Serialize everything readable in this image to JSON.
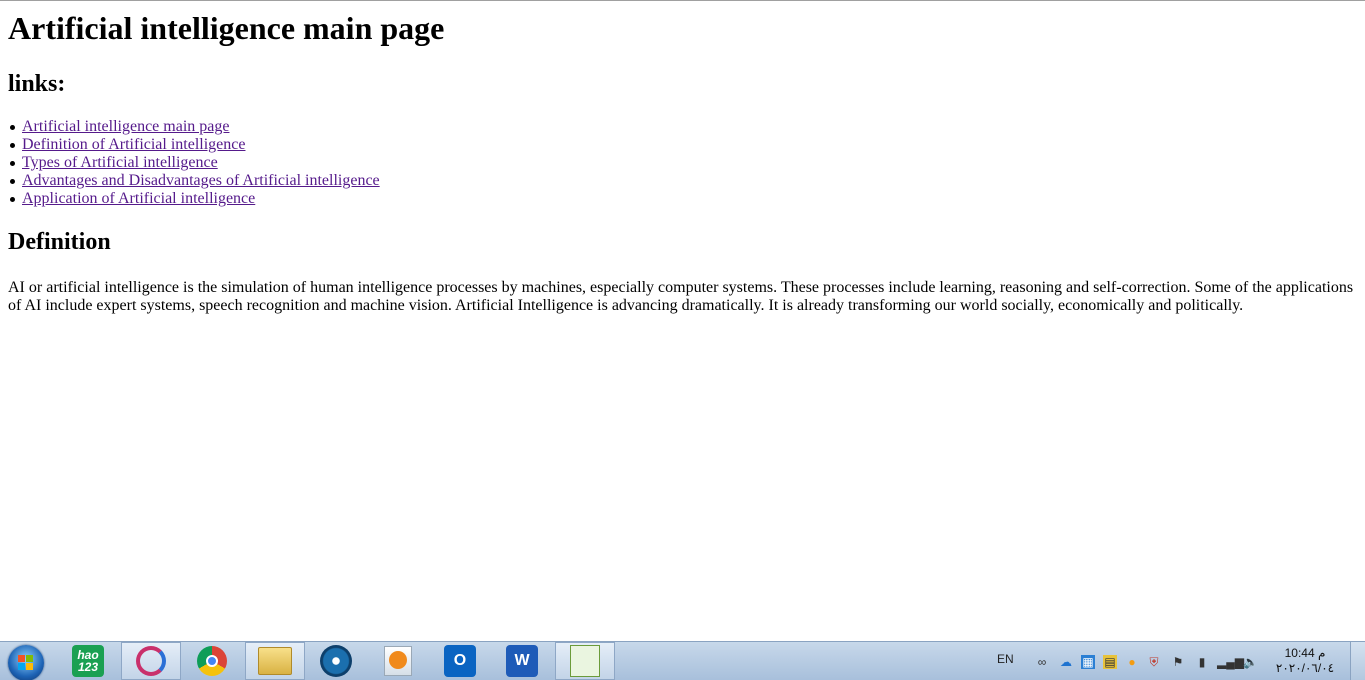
{
  "page": {
    "title": "Artificial intelligence main page",
    "links_heading": "links:",
    "links": [
      "Artificial intelligence main page",
      "Definition of Artificial intelligence",
      "Types of Artificial intelligence",
      "Advantages and Disadvantages of Artificial intelligence",
      "Application of Artificial intelligence"
    ],
    "definition_heading": "Definition",
    "definition_text": "AI or artificial intelligence is the simulation of human intelligence processes by machines, especially computer systems. These processes include learning, reasoning and self-correction. Some of the applications of AI include expert systems, speech recognition and machine vision. Artificial Intelligence is advancing dramatically. It is already transforming our world socially, economically and politically."
  },
  "taskbar": {
    "items": [
      {
        "icon": "hao123-icon",
        "label": "hao\n123"
      },
      {
        "icon": "sogou-browser-icon",
        "label": ""
      },
      {
        "icon": "chrome-icon",
        "label": ""
      },
      {
        "icon": "file-explorer-icon",
        "label": ""
      },
      {
        "icon": "media-icon",
        "label": ""
      },
      {
        "icon": "media-player-icon",
        "label": ""
      },
      {
        "icon": "outlook-icon",
        "label": "O"
      },
      {
        "icon": "word-icon",
        "label": "W"
      },
      {
        "icon": "notepad-icon",
        "label": ""
      }
    ],
    "tray": {
      "language": "EN",
      "time": "10:44 م",
      "date": "٢٠٢٠/٠٦/٠٤"
    }
  },
  "colors": {
    "link_visited": "#551a8b",
    "taskbar": "#b9cde3"
  }
}
